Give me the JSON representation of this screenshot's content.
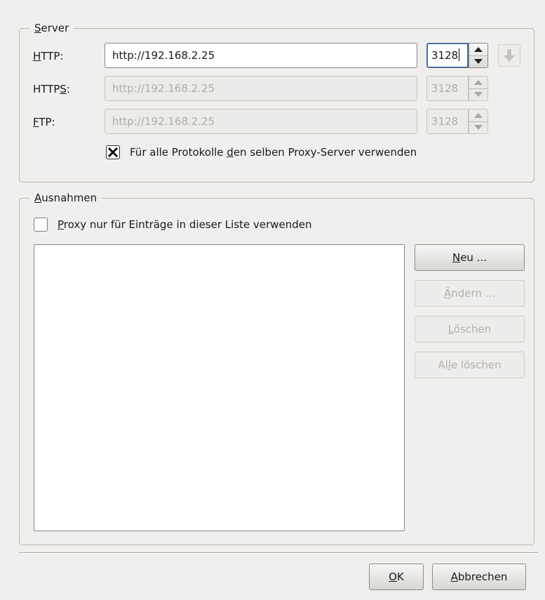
{
  "server": {
    "legend_pre": "",
    "legend_acc": "S",
    "legend_post": "erver",
    "http": {
      "label_pre": "",
      "label_acc": "H",
      "label_post": "TTP:",
      "url": "http://192.168.2.25",
      "port": "3128"
    },
    "https": {
      "label_pre": "HTTP",
      "label_acc": "S",
      "label_post": ":",
      "url": "http://192.168.2.25",
      "port": "3128"
    },
    "ftp": {
      "label_pre": "",
      "label_acc": "F",
      "label_post": "TP:",
      "url": "http://192.168.2.25",
      "port": "3128"
    },
    "same_proxy": {
      "checked": true,
      "label_pre": "Für alle Protokolle ",
      "label_acc": "d",
      "label_post": "en selben Proxy-Server verwenden"
    }
  },
  "exceptions": {
    "legend_pre": "",
    "legend_acc": "A",
    "legend_post": "usnahmen",
    "only_list": {
      "checked": false,
      "label_pre": "",
      "label_acc": "P",
      "label_post": "roxy nur für Einträge in dieser Liste verwenden"
    },
    "items": [],
    "buttons": {
      "new": {
        "pre": "",
        "acc": "N",
        "post": "eu ..."
      },
      "edit": {
        "pre": "",
        "acc": "Ä",
        "post": "ndern ..."
      },
      "del": {
        "pre": "",
        "acc": "L",
        "post": "öschen"
      },
      "clear": {
        "pre": "Al",
        "acc": "l",
        "post": "e löschen"
      }
    }
  },
  "footer": {
    "ok": {
      "pre": "",
      "acc": "O",
      "post": "K"
    },
    "cancel": {
      "pre": "",
      "acc": "A",
      "post": "bbrechen"
    }
  },
  "colors": {
    "window_bg": "#f1efed",
    "focus_border": "#4a6f9e",
    "disabled_text": "#b0ada8"
  }
}
